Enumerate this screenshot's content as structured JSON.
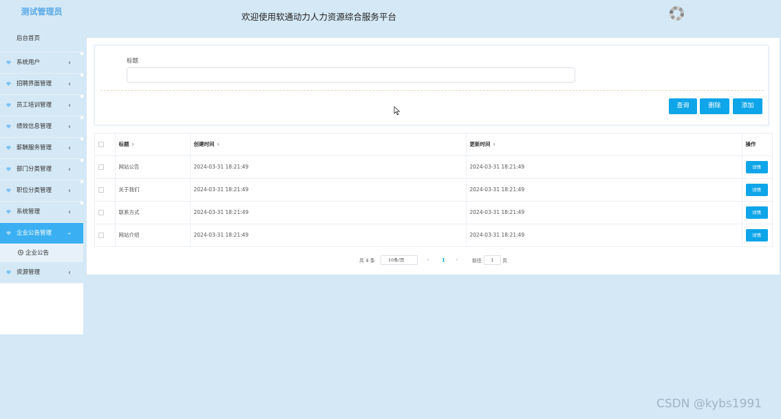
{
  "sidebar": {
    "header": "测试管理员",
    "home": "后台首页",
    "items": [
      {
        "label": "系统用户"
      },
      {
        "label": "招聘界面管理"
      },
      {
        "label": "员工培训管理"
      },
      {
        "label": "绩效信息管理"
      },
      {
        "label": "薪酬服务管理"
      },
      {
        "label": "部门分类管理"
      },
      {
        "label": "职位分类管理"
      },
      {
        "label": "系统管理"
      },
      {
        "label": "企业公告管理",
        "active": true
      },
      {
        "label": "资源管理"
      }
    ],
    "submenu": {
      "label": "企业公告"
    }
  },
  "header": {
    "title": "欢迎使用软通动力人力资源综合服务平台"
  },
  "search": {
    "label": "标题",
    "value": "",
    "buttons": {
      "query": "查询",
      "delete": "删除",
      "add": "添加"
    }
  },
  "table": {
    "columns": {
      "title": "标题",
      "created": "创建时间",
      "updated": "更新时间",
      "actions": "操作"
    },
    "rows": [
      {
        "title": "网站公告",
        "created": "2024-03-31 18:21:49",
        "updated": "2024-03-31 18:21:49",
        "action": "详情"
      },
      {
        "title": "关于我们",
        "created": "2024-03-31 18:21:49",
        "updated": "2024-03-31 18:21:49",
        "action": "详情"
      },
      {
        "title": "联系方式",
        "created": "2024-03-31 18:21:49",
        "updated": "2024-03-31 18:21:49",
        "action": "详情"
      },
      {
        "title": "网站介绍",
        "created": "2024-03-31 18:21:49",
        "updated": "2024-03-31 18:21:49",
        "action": "详情"
      }
    ]
  },
  "pagination": {
    "total": "共 4 条",
    "page_size": "10条/页",
    "current_page": "1",
    "goto_label": "前往",
    "goto_value": "1",
    "goto_unit": "页"
  },
  "watermark": "CSDN @kybs1991",
  "colors": {
    "accent": "#0fa5e9",
    "background": "#d4e8f5",
    "active_menu": "#3ab0f2"
  }
}
